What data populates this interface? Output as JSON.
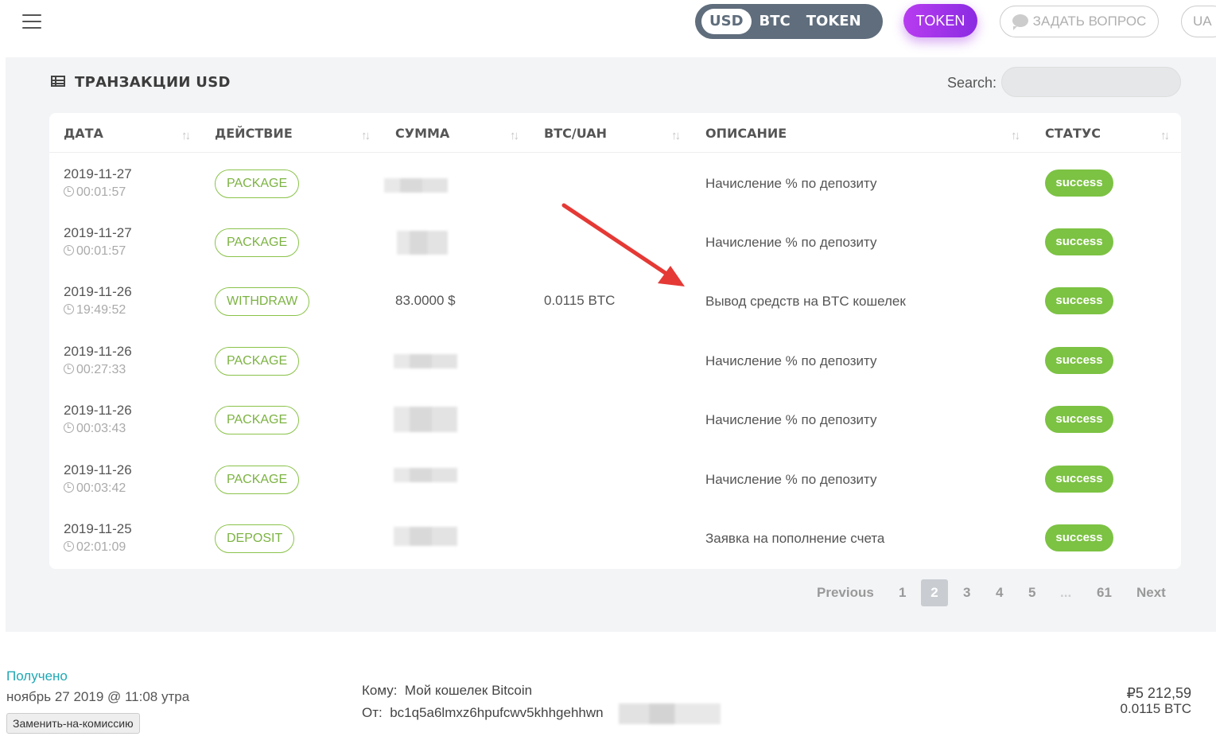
{
  "header": {
    "currencies": [
      "USD",
      "BTC",
      "TOKEN"
    ],
    "active_currency": "USD",
    "token_button": "TOKEN",
    "ask_button": "ЗАДАТЬ ВОПРОС",
    "lang": "UA"
  },
  "panel": {
    "title": "ТРАНЗАКЦИИ USD",
    "search_label": "Search:",
    "search_value": ""
  },
  "table": {
    "columns": [
      "ДАТА",
      "ДЕЙСТВИЕ",
      "СУММА",
      "BTC/UAH",
      "ОПИСАНИЕ",
      "СТАТУС"
    ],
    "rows": [
      {
        "date": "2019-11-27",
        "time": "00:01:57",
        "action": "PACKAGE",
        "amount": "",
        "btc": "",
        "desc": "Начисление % по депозиту",
        "status": "success"
      },
      {
        "date": "2019-11-27",
        "time": "00:01:57",
        "action": "PACKAGE",
        "amount": "",
        "btc": "",
        "desc": "Начисление % по депозиту",
        "status": "success"
      },
      {
        "date": "2019-11-26",
        "time": "19:49:52",
        "action": "WITHDRAW",
        "amount": "83.0000 $",
        "btc": "0.0115 BTC",
        "desc": "Вывод средств на BTC кошелек",
        "status": "success"
      },
      {
        "date": "2019-11-26",
        "time": "00:27:33",
        "action": "PACKAGE",
        "amount": "",
        "btc": "",
        "desc": "Начисление % по депозиту",
        "status": "success"
      },
      {
        "date": "2019-11-26",
        "time": "00:03:43",
        "action": "PACKAGE",
        "amount": "",
        "btc": "",
        "desc": "Начисление % по депозиту",
        "status": "success"
      },
      {
        "date": "2019-11-26",
        "time": "00:03:42",
        "action": "PACKAGE",
        "amount": "",
        "btc": "",
        "desc": "Начисление % по депозиту",
        "status": "success"
      },
      {
        "date": "2019-11-25",
        "time": "02:01:09",
        "action": "DEPOSIT",
        "amount": "",
        "btc": "",
        "desc": "Заявка на пополнение счета",
        "status": "success"
      }
    ]
  },
  "pagination": {
    "previous": "Previous",
    "pages": [
      "1",
      "2",
      "3",
      "4",
      "5",
      "...",
      "61"
    ],
    "current": "2",
    "next": "Next"
  },
  "wallet_tx": {
    "status": "Получено",
    "date": "ноябрь 27 2019 @ 11:08 утра",
    "fee_button": "Заменить-на-комиссию",
    "to_label": "Кому:",
    "to_value": "Мой кошелек Bitcoin",
    "from_label": "От:",
    "from_value": "bc1q5a6lmxz6hpufcwv5khhgehhwn",
    "fiat_amount": "₽5 212,59",
    "crypto_amount": "0.0115 BTC"
  },
  "colors": {
    "accent_green": "#7cc243",
    "token_purple": "#b83cf0",
    "switch_gray": "#5f6d7c",
    "received_teal": "#1fa8b4"
  }
}
